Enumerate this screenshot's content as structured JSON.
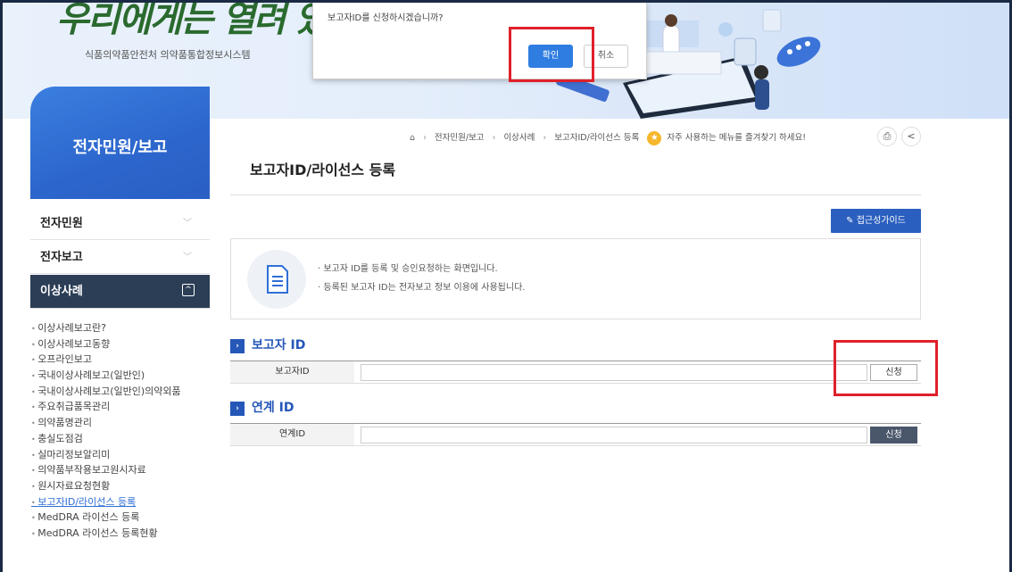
{
  "header": {
    "logo_text": "우리에게는 열려 있습니",
    "site_name": "식품의약품안전처 의약품통합정보시스템"
  },
  "dialog": {
    "message": "보고자ID를 신청하시겠습니까?",
    "ok_label": "확인",
    "cancel_label": "취소"
  },
  "sidebar": {
    "title": "전자민원/보고",
    "items": [
      {
        "label": "전자민원",
        "icon": "chevron-down-icon"
      },
      {
        "label": "전자보고",
        "icon": "chevron-down-icon"
      },
      {
        "label": "이상사례",
        "icon": "collapse-icon"
      }
    ],
    "subitems": [
      "이상사례보고란?",
      "이상사례보고동향",
      "오프라인보고",
      "국내이상사례보고(일반인)",
      "국내이상사례보고(일반인)의약외품",
      "주요취급품목관리",
      "의약품명관리",
      "충실도점검",
      "실마리정보알리미",
      "의약품부작용보고원시자료",
      "원시자료요청현황",
      "보고자ID/라이선스 등록",
      "MedDRA 라이선스 등록",
      "MedDRA 라이선스 등록현황"
    ]
  },
  "breadcrumb": {
    "items": [
      "전자민원/보고",
      "이상사례",
      "보고자ID/라이선스 등록"
    ],
    "favorite_text": "자주 사용하는 메뉴를 즐겨찾기 하세요!"
  },
  "page": {
    "title": "보고자ID/라이선스 등록",
    "guide_button": "접근성가이드",
    "info_lines": [
      "· 보고자 ID를 등록 및 승인요청하는 화면입니다.",
      "· 등록된 보고자 ID는 전자보고 정보 이용에 사용됩니다."
    ]
  },
  "sections": {
    "reporter": {
      "heading": "보고자 ID",
      "field_label": "보고자ID",
      "field_value": "",
      "apply_label": "신청"
    },
    "linked": {
      "heading": "연계 ID",
      "field_label": "연계ID",
      "field_value": "",
      "apply_label": "신청"
    }
  },
  "colors": {
    "accent": "#2557b8",
    "sidebar_active": "#2b3e56",
    "highlight": "#e0202a",
    "ok_button": "#2f7de1"
  }
}
